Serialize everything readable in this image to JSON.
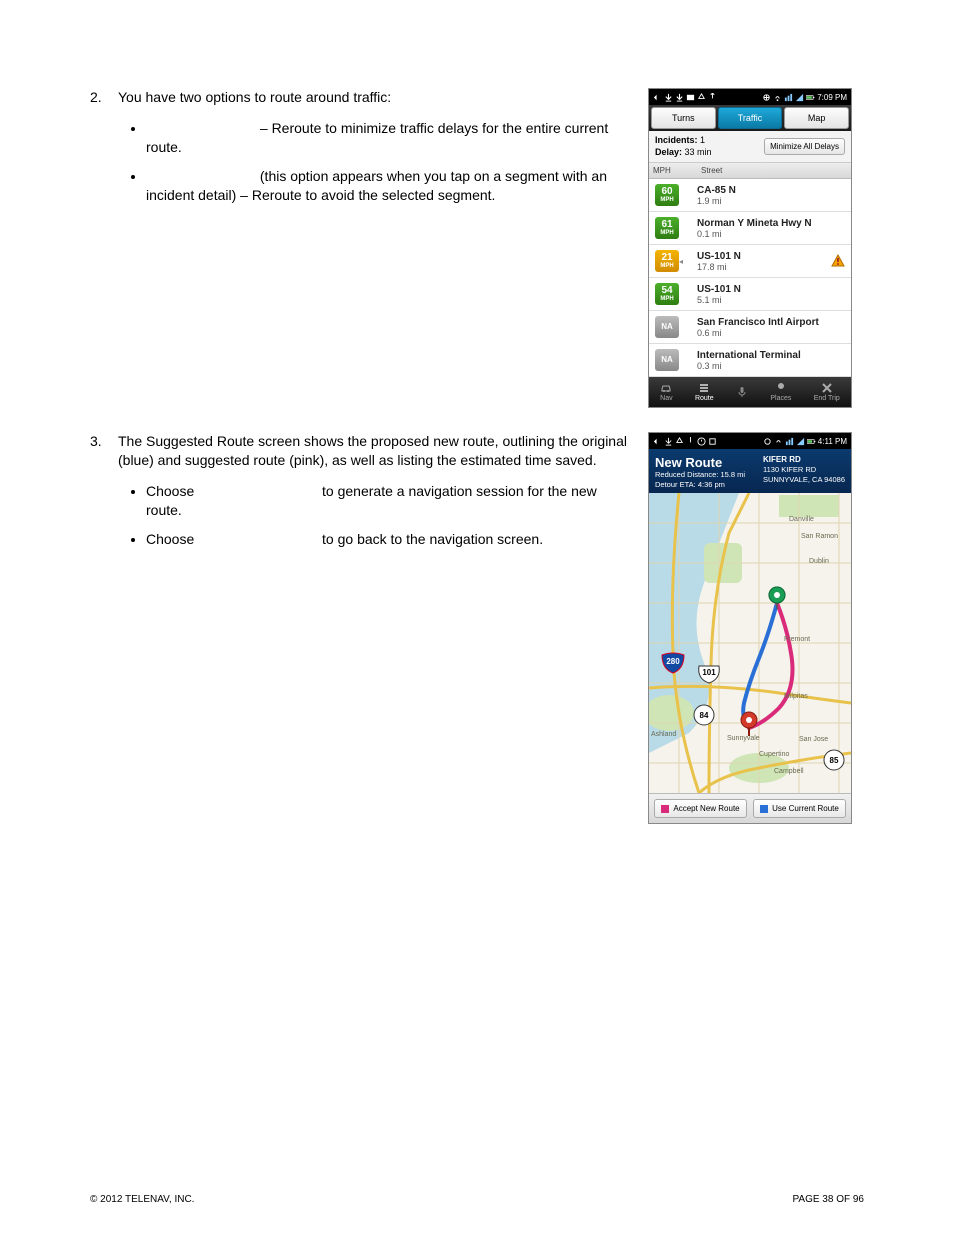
{
  "step2": {
    "number": "2.",
    "lead": "You have two options to route around traffic:",
    "bullets": [
      {
        "pre": "",
        "mid": "– Reroute to minimize traffic delays for the entire current route."
      },
      {
        "pre": "",
        "mid": "(this option appears when you tap on a segment with an incident detail) – Reroute to avoid the selected segment."
      }
    ]
  },
  "step3": {
    "number": "3.",
    "lead": "The Suggested Route screen shows the proposed new route, outlining the original (blue) and suggested route (pink), as well as listing the estimated time saved.",
    "bullets": [
      {
        "pre": "Choose",
        "post": "to generate a navigation session for the new route."
      },
      {
        "pre": "Choose",
        "post": "to go back to the navigation screen."
      }
    ]
  },
  "phone1": {
    "time": "7:09 PM",
    "tabs": {
      "turns": "Turns",
      "traffic": "Traffic",
      "map": "Map"
    },
    "incidents_label": "Incidents:",
    "incidents_value": "1",
    "delay_label": "Delay:",
    "delay_value": "33 min",
    "minimize_btn": "Minimize All Delays",
    "col_mph": "MPH",
    "col_street": "Street",
    "segments": [
      {
        "speed": "60",
        "unit": "MPH",
        "cls": "green",
        "name": "CA-85 N",
        "dist": "1.9 mi",
        "arrow": "",
        "warn": false
      },
      {
        "speed": "61",
        "unit": "MPH",
        "cls": "green",
        "name": "Norman Y Mineta Hwy N",
        "dist": "0.1 mi",
        "arrow": "",
        "warn": false
      },
      {
        "speed": "21",
        "unit": "MPH",
        "cls": "orange",
        "name": "US-101 N",
        "dist": "17.8 mi",
        "arrow": "◂",
        "warn": true
      },
      {
        "speed": "54",
        "unit": "MPH",
        "cls": "green",
        "name": "US-101 N",
        "dist": "5.1 mi",
        "arrow": "",
        "warn": false
      },
      {
        "speed": "NA",
        "unit": "",
        "cls": "na",
        "name": "San Francisco Intl Airport",
        "dist": "0.6 mi",
        "arrow": "",
        "warn": false
      },
      {
        "speed": "NA",
        "unit": "",
        "cls": "na",
        "name": "International Terminal",
        "dist": "0.3 mi",
        "arrow": "",
        "warn": false
      }
    ],
    "bottom": {
      "nav": "Nav",
      "route": "Route",
      "mic": "",
      "places": "Places",
      "end": "End Trip"
    }
  },
  "phone2": {
    "time": "4:11 PM",
    "title": "New Route",
    "reduced_label": "Reduced Distance:",
    "reduced_value": "15.8 mi",
    "eta_label": "Detour ETA:",
    "eta_value": "4:36 pm",
    "dest_name": "KIFER RD",
    "dest_addr1": "1130 KIFER RD",
    "dest_addr2": "SUNNYVALE, CA 94086",
    "shields": {
      "i280": "280",
      "us101": "101",
      "ca84": "84",
      "ca85": "85"
    },
    "cities": {
      "sanramon": "San Ramon",
      "dublin": "Dublin",
      "danville": "Danville",
      "fremont": "Fremont",
      "milpitas": "Milpitas",
      "sunnyvale": "Sunnyvale",
      "cupertino": "Cupertino",
      "campbell": "Campbell",
      "sanjose": "San Jose",
      "ashland": "Ashland"
    },
    "accept_btn": "Accept New Route",
    "current_btn": "Use Current Route"
  },
  "footer": {
    "left": "© 2012 TELENAV, INC.",
    "right": "PAGE 38 OF 96"
  }
}
